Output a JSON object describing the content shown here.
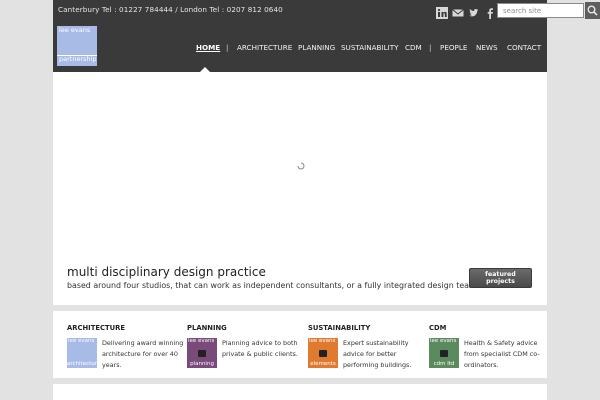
{
  "topbar": {
    "phones": "Canterbury Tel : 01227 784444 / London Tel : 0207 812 0640",
    "social_icons": [
      "linkedin-icon",
      "mail-icon",
      "twitter-icon",
      "facebook-icon"
    ],
    "search": {
      "placeholder": "search site",
      "value": ""
    }
  },
  "header": {
    "logo": {
      "line1": "lee evans",
      "line2": "partnership",
      "color": "#a7bbe6"
    },
    "nav": [
      {
        "label": "HOME",
        "active": true
      },
      {
        "label": "|"
      },
      {
        "label": "ARCHITECTURE"
      },
      {
        "label": "PLANNING"
      },
      {
        "label": "SUSTAINABILITY"
      },
      {
        "label": "CDM"
      },
      {
        "label": "|"
      },
      {
        "label": "PEOPLE"
      },
      {
        "label": "NEWS"
      },
      {
        "label": "CONTACT"
      }
    ]
  },
  "hero": {
    "title": "multi disciplinary design practice",
    "subtitle": "based around four studios, that can work as independent consultants, or a fully integrated design team.",
    "button": "featured projects"
  },
  "studios": [
    {
      "title": "ARCHITECTURE",
      "tile_top": "lee evans",
      "tile_bottom": "architecture",
      "color": "#a7bbe6",
      "desc": "Delivering award winning architecture for over 40 years."
    },
    {
      "title": "PLANNING",
      "tile_top": "lee evans",
      "tile_bottom": "planning",
      "color": "#7a4a7a",
      "desc": "Planning advice to both private & public clients."
    },
    {
      "title": "SUSTAINABILITY",
      "tile_top": "lee evans",
      "tile_bottom": "elements",
      "color": "#e07a30",
      "desc": "Expert sustainability advice for better performing buildings."
    },
    {
      "title": "CDM",
      "tile_top": "lee evans",
      "tile_bottom": "cdm ltd",
      "color": "#5a8a5e",
      "desc": "Health & Safety advice from specialist CDM co-ordinators."
    }
  ]
}
